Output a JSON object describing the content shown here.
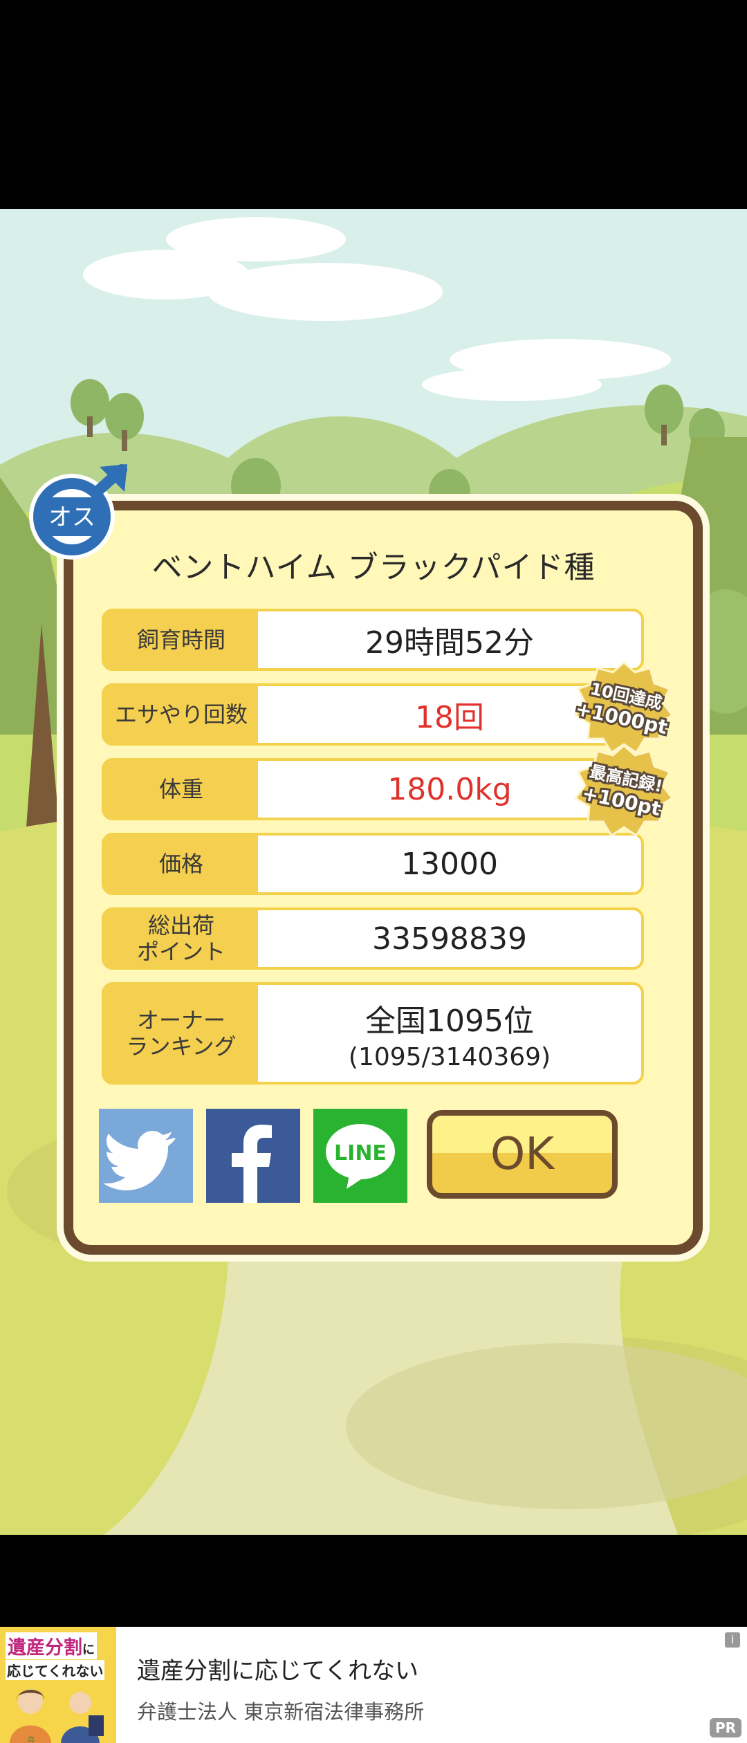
{
  "gender": {
    "label": "オス",
    "symbol": "♂"
  },
  "species": "ベントハイム ブラックパイド種",
  "stats": [
    {
      "label": "飼育時間",
      "value": "29時間52分",
      "highlight": false
    },
    {
      "label": "エサやり回数",
      "value": "18回",
      "highlight": true
    },
    {
      "label": "体重",
      "value": "180.0kg",
      "highlight": true
    },
    {
      "label": "価格",
      "value": "13000",
      "highlight": false
    },
    {
      "label_lines": [
        "総出荷",
        "ポイント"
      ],
      "value": "33598839",
      "highlight": false
    },
    {
      "label_lines": [
        "オーナー",
        "ランキング"
      ],
      "value": "全国1095位",
      "subvalue": "(1095/3140369)",
      "highlight": false
    }
  ],
  "bonuses": [
    {
      "line1": "10回達成",
      "line2": "+1000pt"
    },
    {
      "line1": "最高記録!",
      "line2": "+100pt"
    }
  ],
  "share": {
    "twitter": "twitter-share",
    "facebook": "facebook-share",
    "line": "LINE"
  },
  "ok_label": "OK",
  "ad": {
    "thumb_line1": "遺産分割",
    "thumb_line1_suffix": "に",
    "thumb_line2": "応じてくれない",
    "title": "遺産分割に応じてくれない",
    "sponsor": "弁護士法人 東京新宿法律事務所",
    "info_icon": "i",
    "pr": "PR"
  },
  "colors": {
    "accent_red": "#e0322c",
    "label_bg": "#f5cf4f",
    "panel_bg": "#fff8b9",
    "border": "#6b4a2e"
  }
}
